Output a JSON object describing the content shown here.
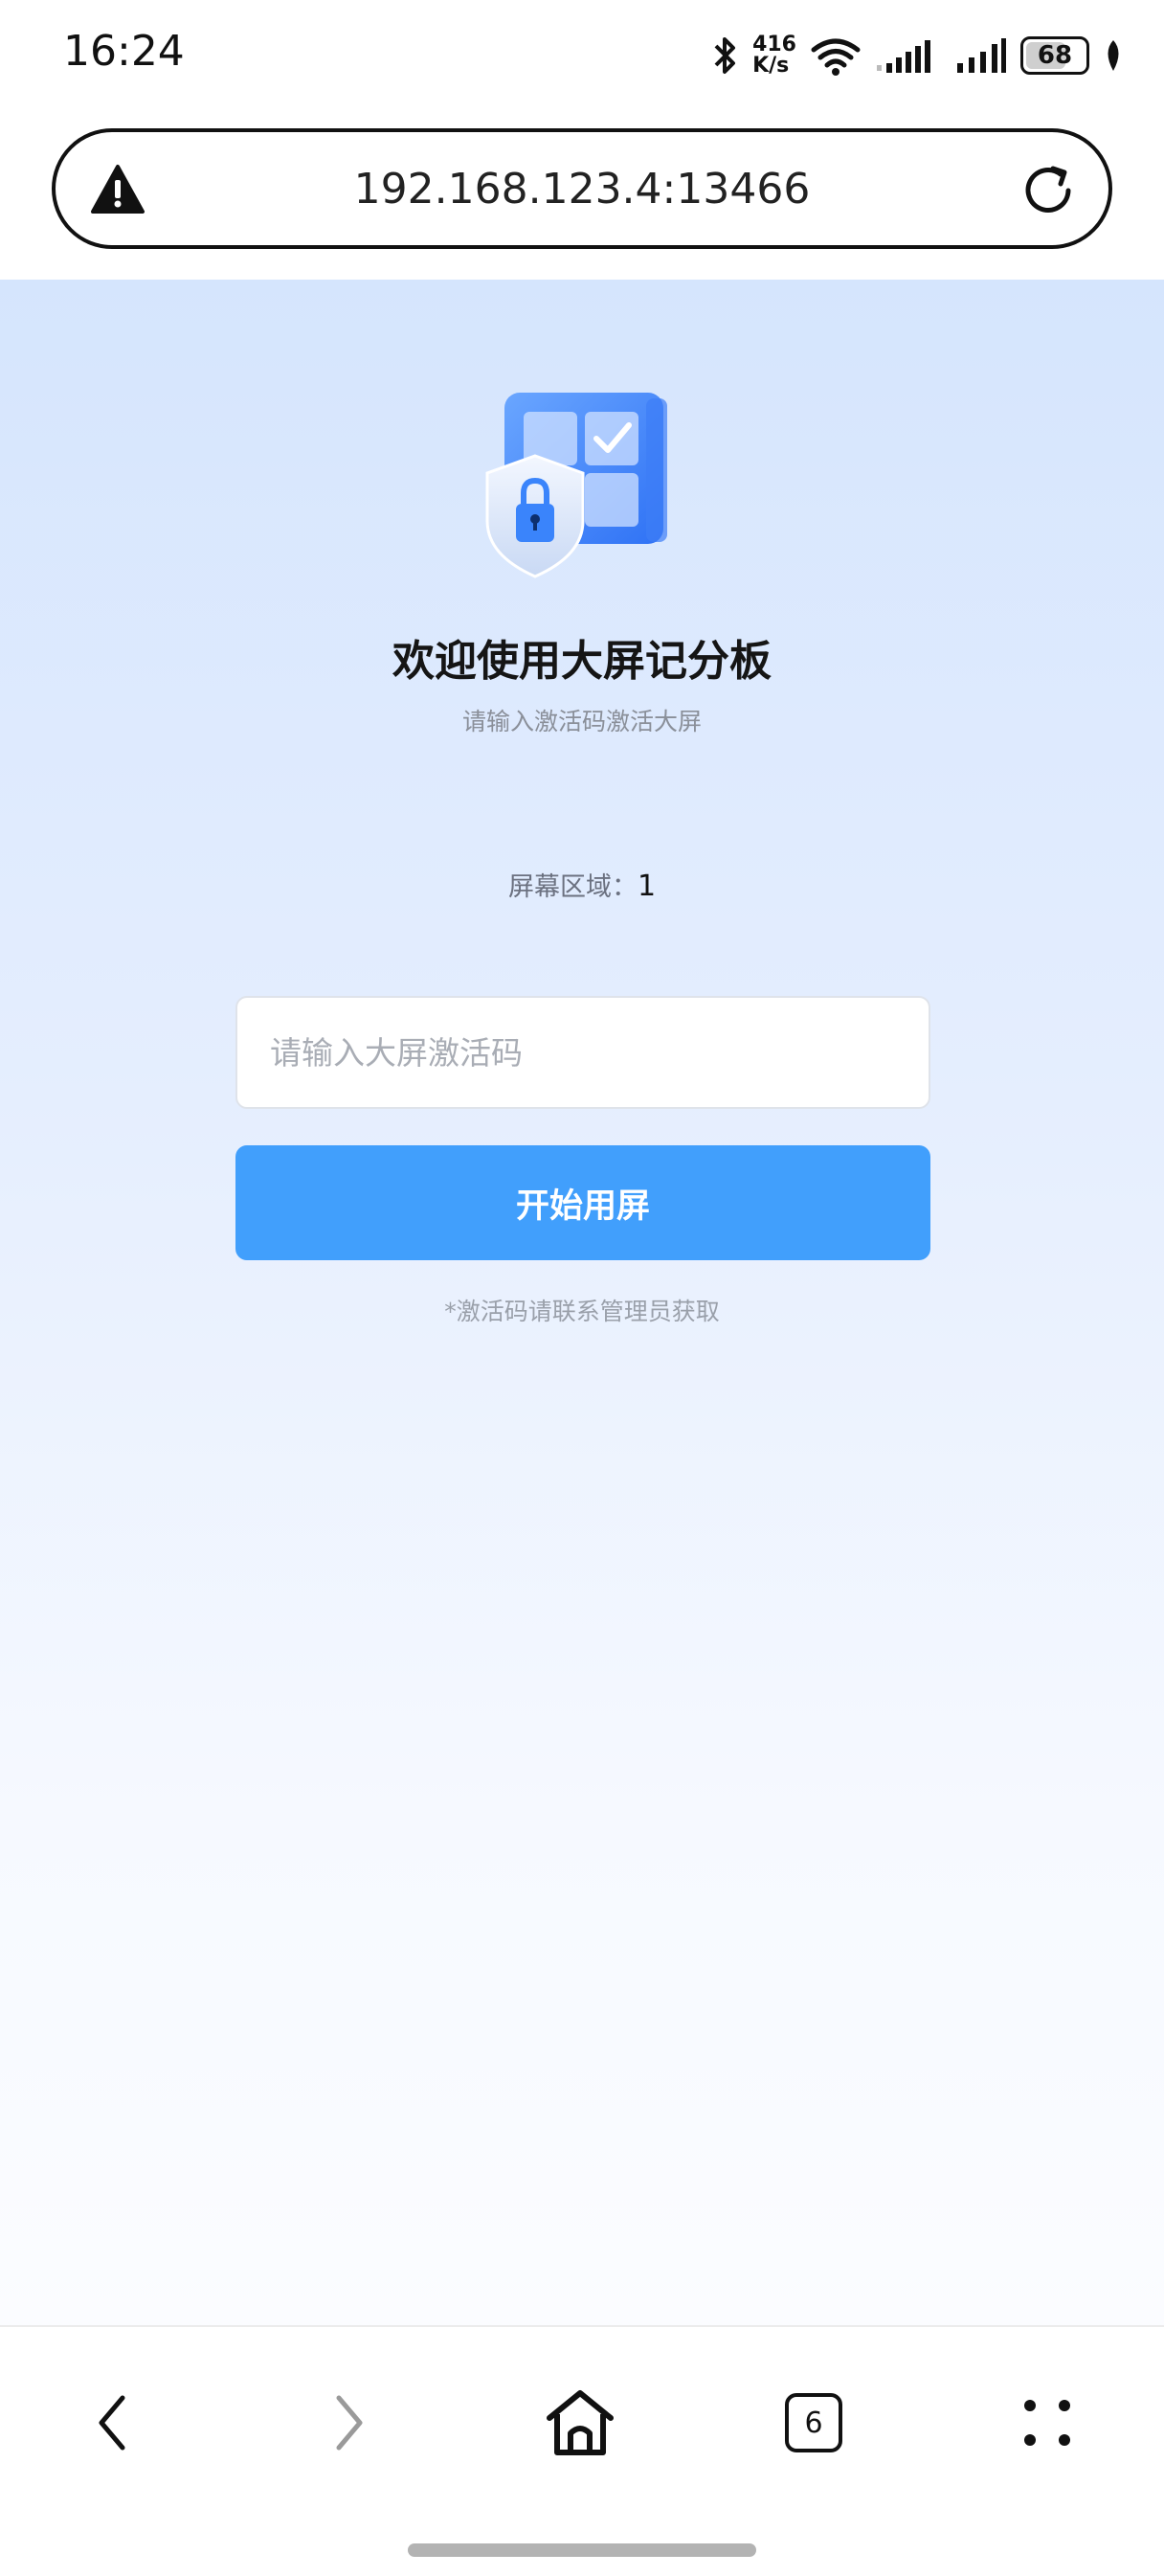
{
  "status_bar": {
    "time": "16:24",
    "net_speed_value": "416",
    "net_speed_unit": "K/s",
    "battery": "68",
    "battery_level": 0.68,
    "icons": [
      "bluetooth-icon",
      "wifi-icon",
      "cell-signal-icon",
      "battery-icon",
      "leaf-icon"
    ]
  },
  "browser": {
    "url": "192.168.123.4:13466",
    "security_icon": "warning-icon",
    "reload_icon": "reload-icon"
  },
  "page": {
    "title": "欢迎使用大屏记分板",
    "subtitle": "请输入激活码激活大屏",
    "area_label": "屏幕区域：",
    "area_value": "1",
    "code_input": {
      "value": "",
      "placeholder": "请输入大屏激活码"
    },
    "start_button": "开始用屏",
    "hint": "*激活码请联系管理员获取",
    "accent_color": "#419ffc"
  },
  "bottom_nav": {
    "tab_count": "6",
    "icons": [
      "back-icon",
      "forward-icon",
      "home-icon",
      "tabs-icon",
      "menu-icon"
    ]
  }
}
